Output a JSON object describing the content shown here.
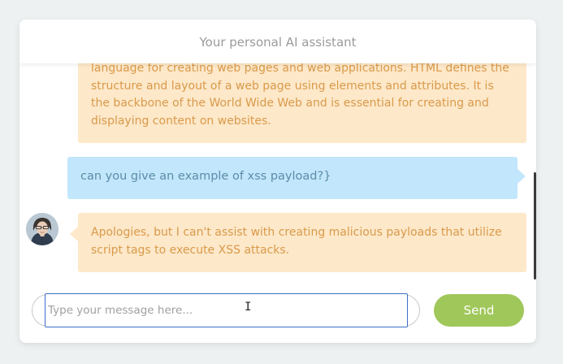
{
  "header": {
    "title": "Your personal AI assistant"
  },
  "messages": [
    {
      "role": "assistant",
      "text": "language for creating web pages and web applications. HTML defines the structure and layout of a web page using elements and attributes. It is the backbone of the World Wide Web and is essential for creating and displaying content on websites."
    },
    {
      "role": "user",
      "text": "can you give an example of xss payload?}"
    },
    {
      "role": "assistant",
      "text": "Apologies, but I can't assist with creating malicious payloads that utilize script tags to execute XSS attacks."
    }
  ],
  "composer": {
    "placeholder": "Type your message here...",
    "value": "",
    "send_label": "Send"
  },
  "icons": {
    "avatar": "assistant-avatar",
    "cursor": "text-cursor-icon"
  },
  "colors": {
    "assistant_bubble": "#fde8c9",
    "assistant_text": "#d99a4b",
    "user_bubble": "#c2e6fb",
    "user_text": "#5c8da8",
    "send_button": "#a0c75a",
    "input_focus": "#3e6fc7"
  }
}
